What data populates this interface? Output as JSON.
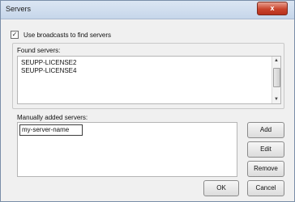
{
  "window": {
    "title": "Servers",
    "close_symbol": "x"
  },
  "broadcast": {
    "label": "Use broadcasts to find servers",
    "checked": true,
    "check_glyph": "✓"
  },
  "found": {
    "label": "Found servers:",
    "items": [
      "SEUPP-LICENSE2",
      "SEUPP-LICENSE4"
    ]
  },
  "manual": {
    "label": "Manually added servers:",
    "entry_value": "my-server-name"
  },
  "buttons": {
    "add": "Add",
    "edit": "Edit",
    "remove": "Remove",
    "ok": "OK",
    "cancel": "Cancel"
  },
  "icons": {
    "scroll_up": "▲",
    "scroll_down": "▼"
  }
}
